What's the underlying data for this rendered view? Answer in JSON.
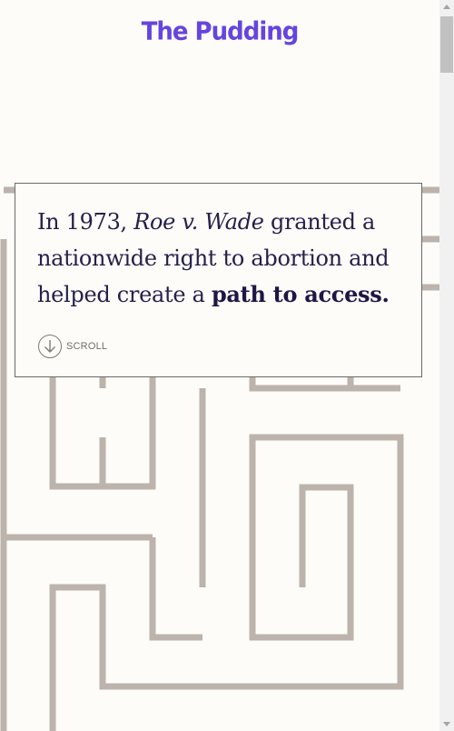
{
  "header": {
    "logo_text": "The Pudding"
  },
  "intro": {
    "text_prefix": "In 1973, ",
    "case_name": "Roe v. Wade",
    "text_middle": " granted a nationwide right to abortion and helped create a ",
    "emphasis": "path to access."
  },
  "scroll_prompt": {
    "label": "SCROLL",
    "icon": "arrow-down-circle-icon"
  },
  "colors": {
    "brand": "#6644e0",
    "maze": "#bcb3ac",
    "text": "#262049",
    "background": "#fdfcf9"
  }
}
